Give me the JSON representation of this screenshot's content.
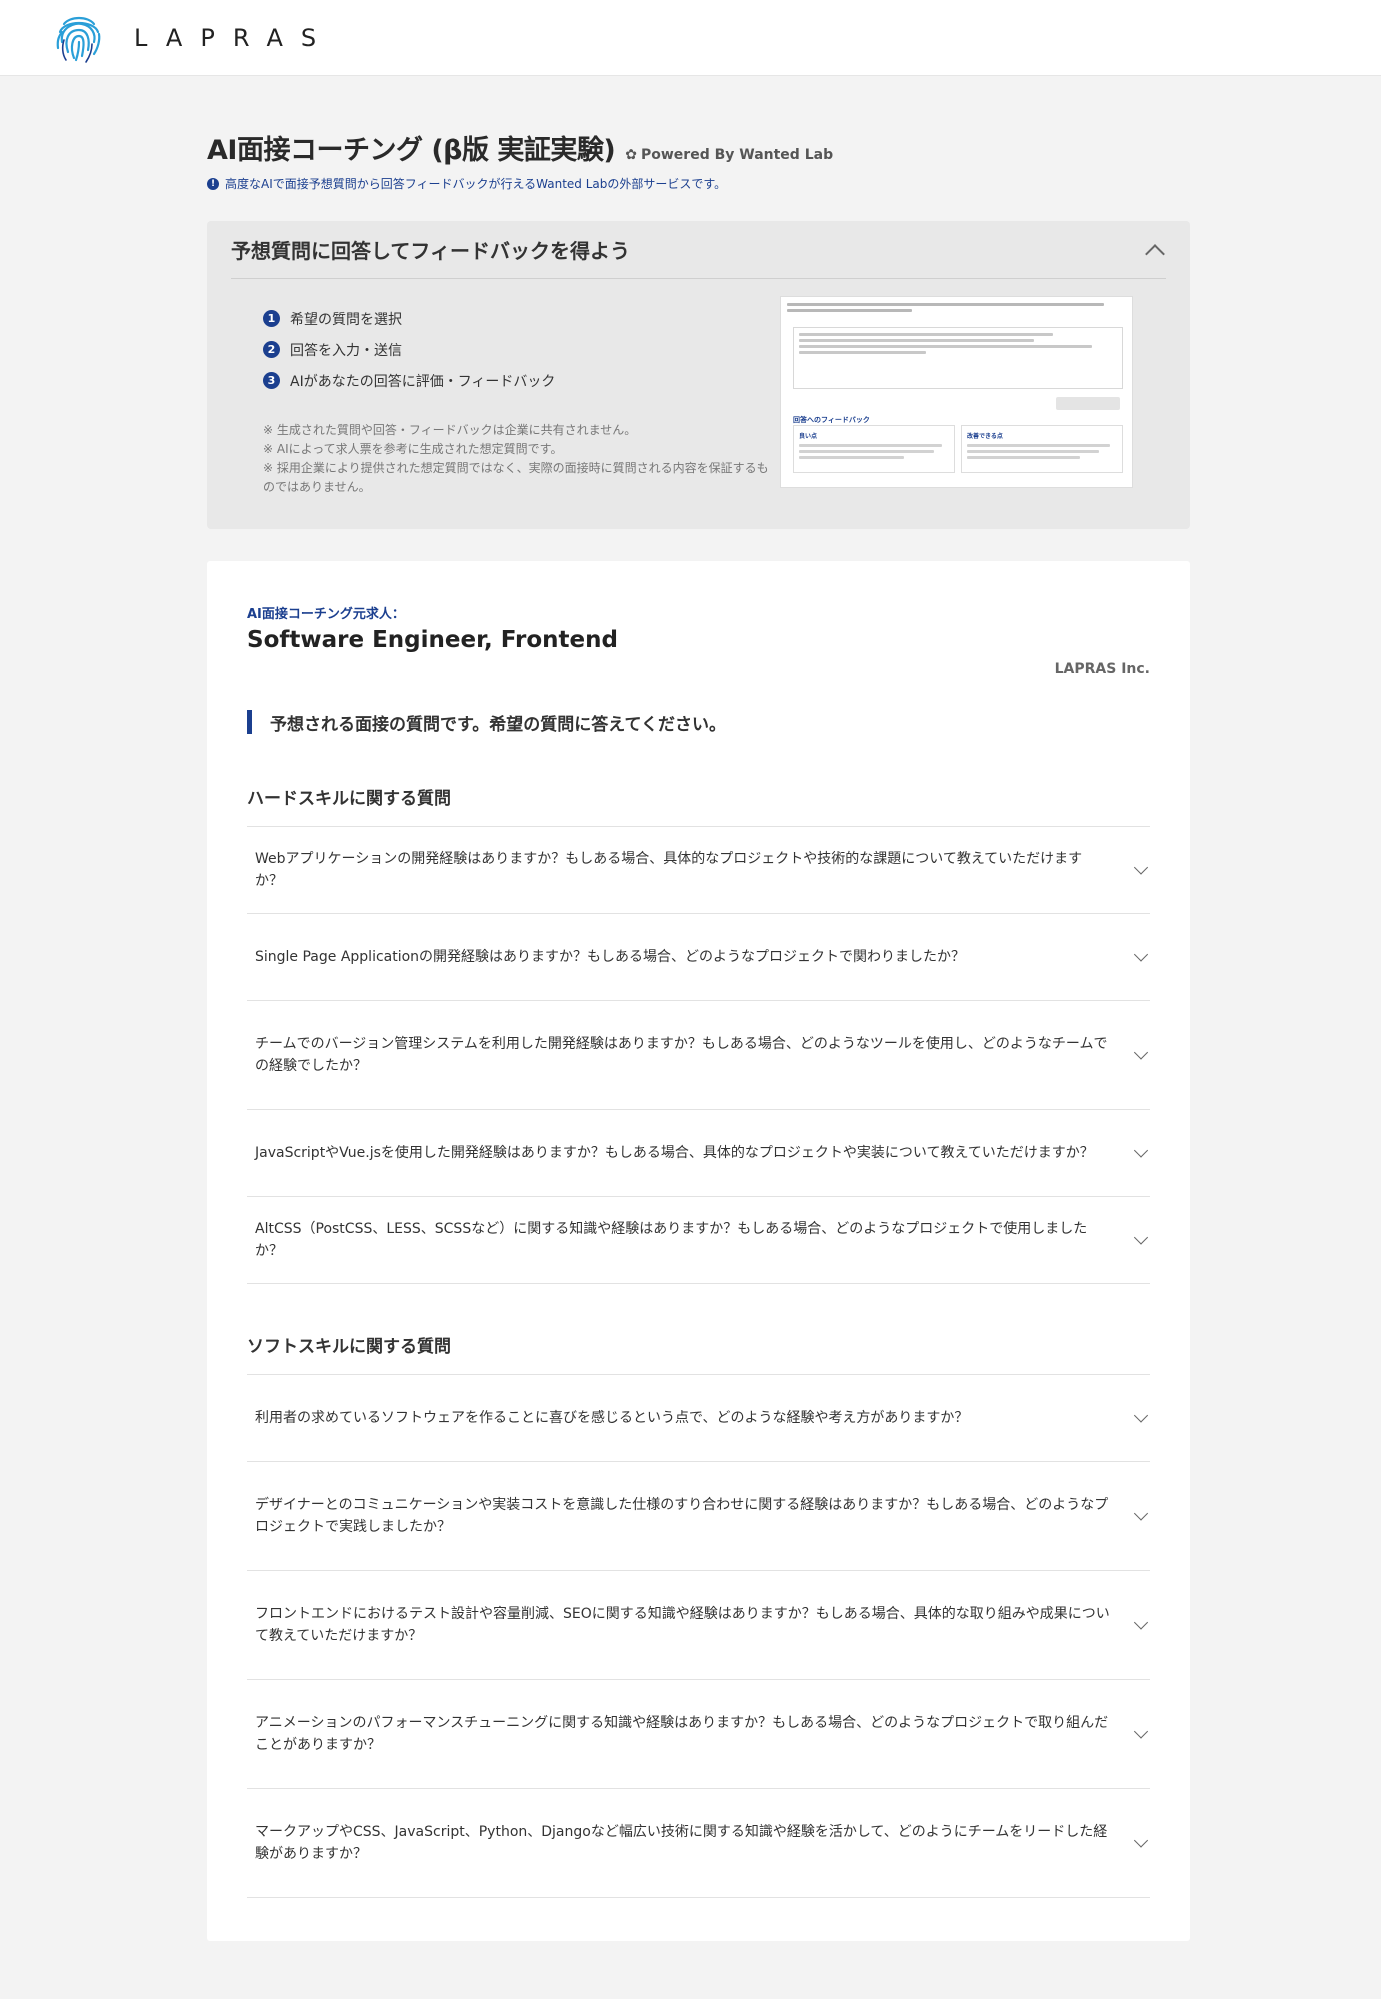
{
  "header": {
    "brand": "LAPRAS"
  },
  "page": {
    "title": "AI面接コーチング (β版 実証実験)",
    "powered_by": "Powered By Wanted Lab",
    "info": "高度なAIで面接予想質問から回答フィードバックが行えるWanted Labの外部サービスです。"
  },
  "howto": {
    "title": "予想質問に回答してフィードバックを得よう",
    "steps": [
      {
        "num": "1",
        "label": "希望の質問を選択"
      },
      {
        "num": "2",
        "label": "回答を入力・送信"
      },
      {
        "num": "3",
        "label": "AIがあなたの回答に評価・フィードバック"
      }
    ],
    "notes": [
      "※ 生成された質問や回答・フィードバックは企業に共有されません。",
      "※ AIによって求人票を参考に生成された想定質問です。",
      "※ 採用企業により提供された想定質問ではなく、実際の面接時に質問される内容を保証するものではありません。"
    ],
    "preview": {
      "feedback_label": "回答へのフィードバック",
      "good_label": "良い点",
      "improve_label": "改善できる点"
    }
  },
  "job": {
    "source_label": "AI面接コーチング元求人：",
    "title": "Software Engineer, Frontend",
    "company": "LAPRAS Inc.",
    "lead": "予想される面接の質問です。希望の質問に答えてください。"
  },
  "hard_skills": {
    "title": "ハードスキルに関する質問",
    "questions": [
      "Webアプリケーションの開発経験はありますか？もしある場合、具体的なプロジェクトや技術的な課題について教えていただけますか？",
      "Single Page Applicationの開発経験はありますか？もしある場合、どのようなプロジェクトで関わりましたか？",
      "チームでのバージョン管理システムを利用した開発経験はありますか？もしある場合、どのようなツールを使用し、どのようなチームでの経験でしたか？",
      "JavaScriptやVue.jsを使用した開発経験はありますか？もしある場合、具体的なプロジェクトや実装について教えていただけますか？",
      "AltCSS（PostCSS、LESS、SCSSなど）に関する知識や経験はありますか？もしある場合、どのようなプロジェクトで使用しましたか？"
    ]
  },
  "soft_skills": {
    "title": "ソフトスキルに関する質問",
    "questions": [
      "利用者の求めているソフトウェアを作ることに喜びを感じるという点で、どのような経験や考え方がありますか？",
      "デザイナーとのコミュニケーションや実装コストを意識した仕様のすり合わせに関する経験はありますか？もしある場合、どのようなプロジェクトで実践しましたか？",
      "フロントエンドにおけるテスト設計や容量削減、SEOに関する知識や経験はありますか？もしある場合、具体的な取り組みや成果について教えていただけますか？",
      "アニメーションのパフォーマンスチューニングに関する知識や経験はありますか？もしある場合、どのようなプロジェクトで取り組んだことがありますか？",
      "マークアップやCSS、JavaScript、Python、Djangoなど幅広い技術に関する知識や経験を活かして、どのようにチームをリードした経験がありますか？"
    ]
  },
  "colors": {
    "accent": "#1b3f8f",
    "logo": "#2a9fd8"
  }
}
